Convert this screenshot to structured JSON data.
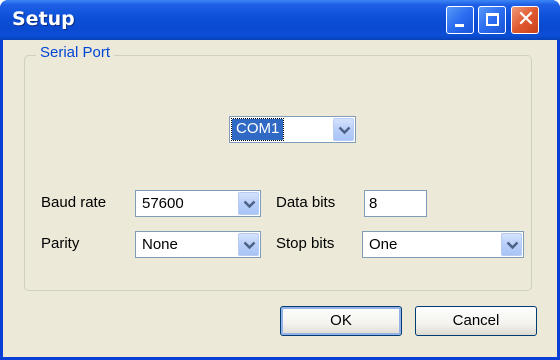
{
  "window": {
    "title": "Setup"
  },
  "serial_port": {
    "group_label": "Serial Port",
    "port": "COM1"
  },
  "fields": {
    "baud_rate": {
      "label": "Baud rate",
      "value": "57600"
    },
    "data_bits": {
      "label": "Data bits",
      "value": "8"
    },
    "parity": {
      "label": "Parity",
      "value": "None"
    },
    "stop_bits": {
      "label": "Stop bits",
      "value": "One"
    }
  },
  "buttons": {
    "ok": "OK",
    "cancel": "Cancel"
  },
  "colors": {
    "titlebar": "#0a49d0",
    "client_bg": "#ece9d8",
    "group_label": "#0046d5",
    "selection": "#316ac5"
  }
}
